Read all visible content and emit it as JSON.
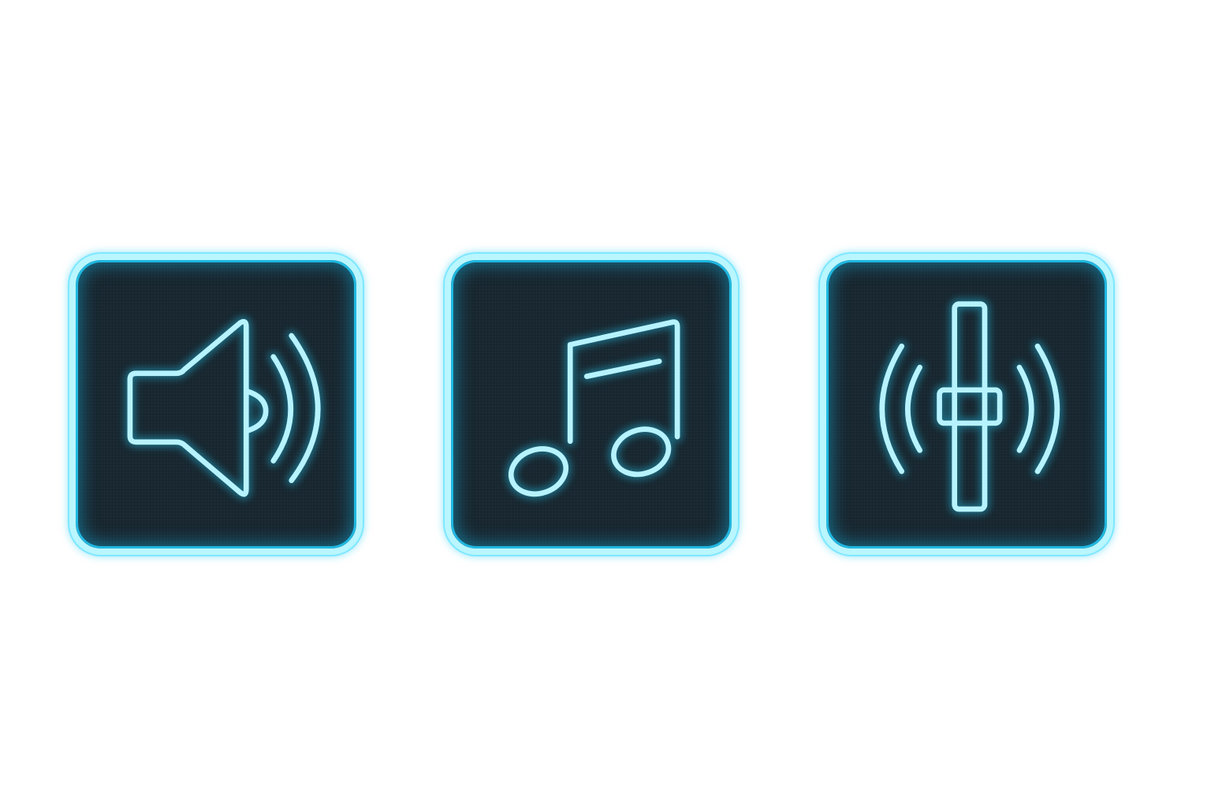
{
  "icons": [
    {
      "name": "speaker-volume-icon",
      "semantic": "volume"
    },
    {
      "name": "music-note-icon",
      "semantic": "music"
    },
    {
      "name": "audio-slider-icon",
      "semantic": "audio-level"
    }
  ],
  "colors": {
    "background": "#ffffff",
    "tile_fill": "#17262f",
    "neon_stroke": "#b7f3ff",
    "glow": "#21c3ea",
    "border": "#b9f6ff"
  }
}
